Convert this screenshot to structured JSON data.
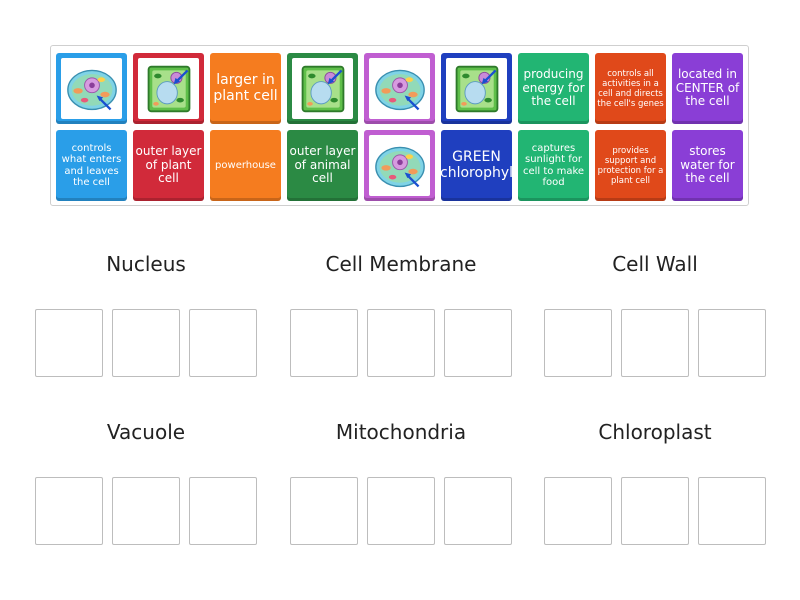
{
  "colors": {
    "blue": "#2a9ee8",
    "red": "#d12a3a",
    "orange": "#f57c1f",
    "green": "#2b8a44",
    "pink": "#c05ed1",
    "navy": "#1f3fbf",
    "teal": "#22b573",
    "darkorange": "#e0491a",
    "purple": "#8a3ed6"
  },
  "tiles_row1": [
    {
      "kind": "image",
      "icon": "animal-cell-icon",
      "color": "blue"
    },
    {
      "kind": "image",
      "icon": "plant-cell-icon",
      "color": "red"
    },
    {
      "kind": "text",
      "text": "larger in plant cell",
      "color": "orange"
    },
    {
      "kind": "image",
      "icon": "plant-cell-icon",
      "color": "green"
    },
    {
      "kind": "image",
      "icon": "animal-cell-icon",
      "color": "pink"
    },
    {
      "kind": "image",
      "icon": "plant-cell-icon",
      "color": "navy"
    },
    {
      "kind": "text",
      "text": "producing energy for the cell",
      "color": "teal"
    },
    {
      "kind": "text",
      "text": "controls all activities in a cell and directs the cell's genes",
      "color": "darkorange"
    },
    {
      "kind": "text",
      "text": "located in CENTER of the cell",
      "color": "purple"
    }
  ],
  "tiles_row2": [
    {
      "kind": "text",
      "text": "controls what enters and leaves the cell",
      "color": "blue"
    },
    {
      "kind": "text",
      "text": "outer layer of plant cell",
      "color": "red"
    },
    {
      "kind": "text",
      "text": "powerhouse",
      "color": "orange"
    },
    {
      "kind": "text",
      "text": "outer layer of animal cell",
      "color": "green"
    },
    {
      "kind": "image",
      "icon": "animal-cell-icon",
      "color": "pink"
    },
    {
      "kind": "text",
      "text": "GREEN (chlorophyl)",
      "color": "navy"
    },
    {
      "kind": "text",
      "text": "captures sunlight for cell to make food",
      "color": "teal"
    },
    {
      "kind": "text",
      "text": "provides support and protection for a plant cell",
      "color": "darkorange"
    },
    {
      "kind": "text",
      "text": "stores water for the cell",
      "color": "purple"
    }
  ],
  "groups": [
    {
      "label": "Nucleus"
    },
    {
      "label": "Cell Membrane"
    },
    {
      "label": "Cell Wall"
    },
    {
      "label": "Vacuole"
    },
    {
      "label": "Mitochondria"
    },
    {
      "label": "Chloroplast"
    }
  ]
}
